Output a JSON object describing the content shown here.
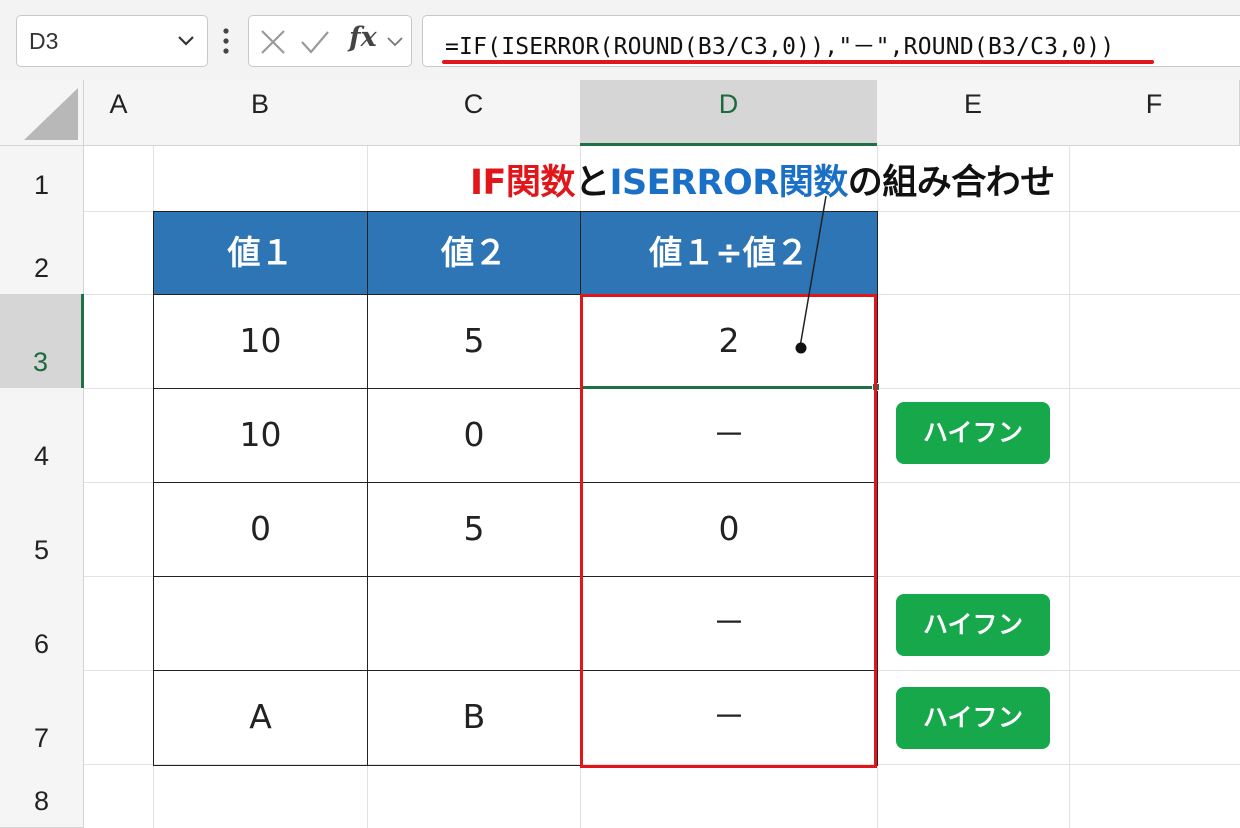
{
  "formula_bar": {
    "name_box": "D3",
    "formula": "=IF(ISERROR(ROUND(B3/C3,0)),\"－\",ROUND(B3/C3,0))"
  },
  "columns": [
    "A",
    "B",
    "C",
    "D",
    "E",
    "F"
  ],
  "rows": [
    "1",
    "2",
    "3",
    "4",
    "5",
    "6",
    "7",
    "8"
  ],
  "annotation": {
    "title_part1": "IF関数",
    "title_part2": "と",
    "title_part3": "ISERROR関数",
    "title_part4": "の組み合わせ"
  },
  "table": {
    "headers": [
      "値１",
      "値２",
      "値１÷値２"
    ],
    "rows": [
      {
        "b": "10",
        "c": "5",
        "d": "2"
      },
      {
        "b": "10",
        "c": "0",
        "d": "－"
      },
      {
        "b": "0",
        "c": "5",
        "d": "0"
      },
      {
        "b": "",
        "c": "",
        "d": "－"
      },
      {
        "b": "A",
        "c": "B",
        "d": "－"
      }
    ]
  },
  "labels": {
    "hyphen_1": "ハイフン",
    "hyphen_2": "ハイフン",
    "hyphen_3": "ハイフン"
  },
  "colors": {
    "header_blue": "#2e75b6",
    "highlight_red": "#e0161b",
    "label_green": "#16a84b",
    "title_blue": "#1a6fc7",
    "selection_green": "#1e7145"
  },
  "icons": [
    "chevron-down-icon",
    "more-options-icon",
    "cancel-icon",
    "enter-icon",
    "insert-function-icon",
    "select-all-icon"
  ]
}
